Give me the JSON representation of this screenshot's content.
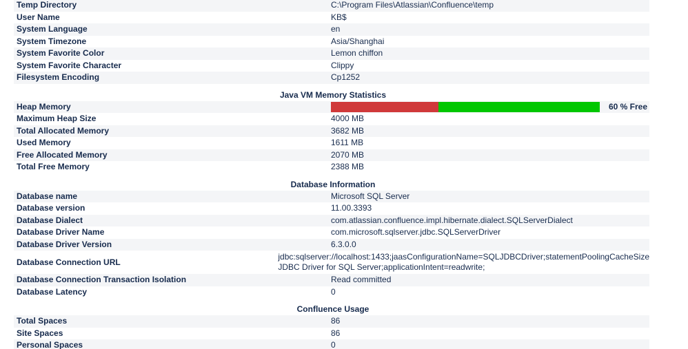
{
  "colors": {
    "used": "#d0393a",
    "free": "#00c700"
  },
  "system_rows": [
    {
      "label": "Temp Directory",
      "value": "C:\\Program Files\\Atlassian\\Confluence\\temp"
    },
    {
      "label": "User Name",
      "value": "KB$"
    },
    {
      "label": "System Language",
      "value": "en"
    },
    {
      "label": "System Timezone",
      "value": "Asia/Shanghai"
    },
    {
      "label": "System Favorite Color",
      "value": "Lemon chiffon"
    },
    {
      "label": "System Favorite Character",
      "value": "Clippy"
    },
    {
      "label": "Filesystem Encoding",
      "value": "Cp1252"
    }
  ],
  "jvm": {
    "title": "Java VM Memory Statistics",
    "heap_label": "Heap Memory",
    "free_percent": 60,
    "free_text": "60 % Free",
    "rows": [
      {
        "label": "Maximum Heap Size",
        "value": "4000 MB"
      },
      {
        "label": "Total Allocated Memory",
        "value": "3682 MB"
      },
      {
        "label": "Used Memory",
        "value": "1611 MB"
      },
      {
        "label": "Free Allocated Memory",
        "value": "2070 MB"
      },
      {
        "label": "Total Free Memory",
        "value": "2388 MB"
      }
    ]
  },
  "database": {
    "title": "Database Information",
    "rows": [
      {
        "label": "Database name",
        "value": "Microsoft SQL Server"
      },
      {
        "label": "Database version",
        "value": "11.00.3393"
      },
      {
        "label": "Database Dialect",
        "value": "com.atlassian.confluence.impl.hibernate.dialect.SQLServerDialect"
      },
      {
        "label": "Database Driver Name",
        "value": "com.microsoft.sqlserver.jdbc.SQLServerDriver"
      },
      {
        "label": "Database Driver Version",
        "value": "6.3.0.0"
      }
    ],
    "connection_url": {
      "label": "Database Connection URL",
      "line1": "jdbc:sqlserver://localhost:1433;jaasConfigurationName=SQLJDBCDriver;statementPoolingCacheSize",
      "line2": "JDBC Driver for SQL Server;applicationIntent=readwrite;"
    },
    "rows2": [
      {
        "label": "Database Connection Transaction Isolation",
        "value": "Read committed"
      },
      {
        "label": "Database Latency",
        "value": "0"
      }
    ]
  },
  "usage": {
    "title": "Confluence Usage",
    "rows": [
      {
        "label": "Total Spaces",
        "value": "86"
      },
      {
        "label": "Site Spaces",
        "value": "86"
      },
      {
        "label": "Personal Spaces",
        "value": "0"
      }
    ]
  }
}
